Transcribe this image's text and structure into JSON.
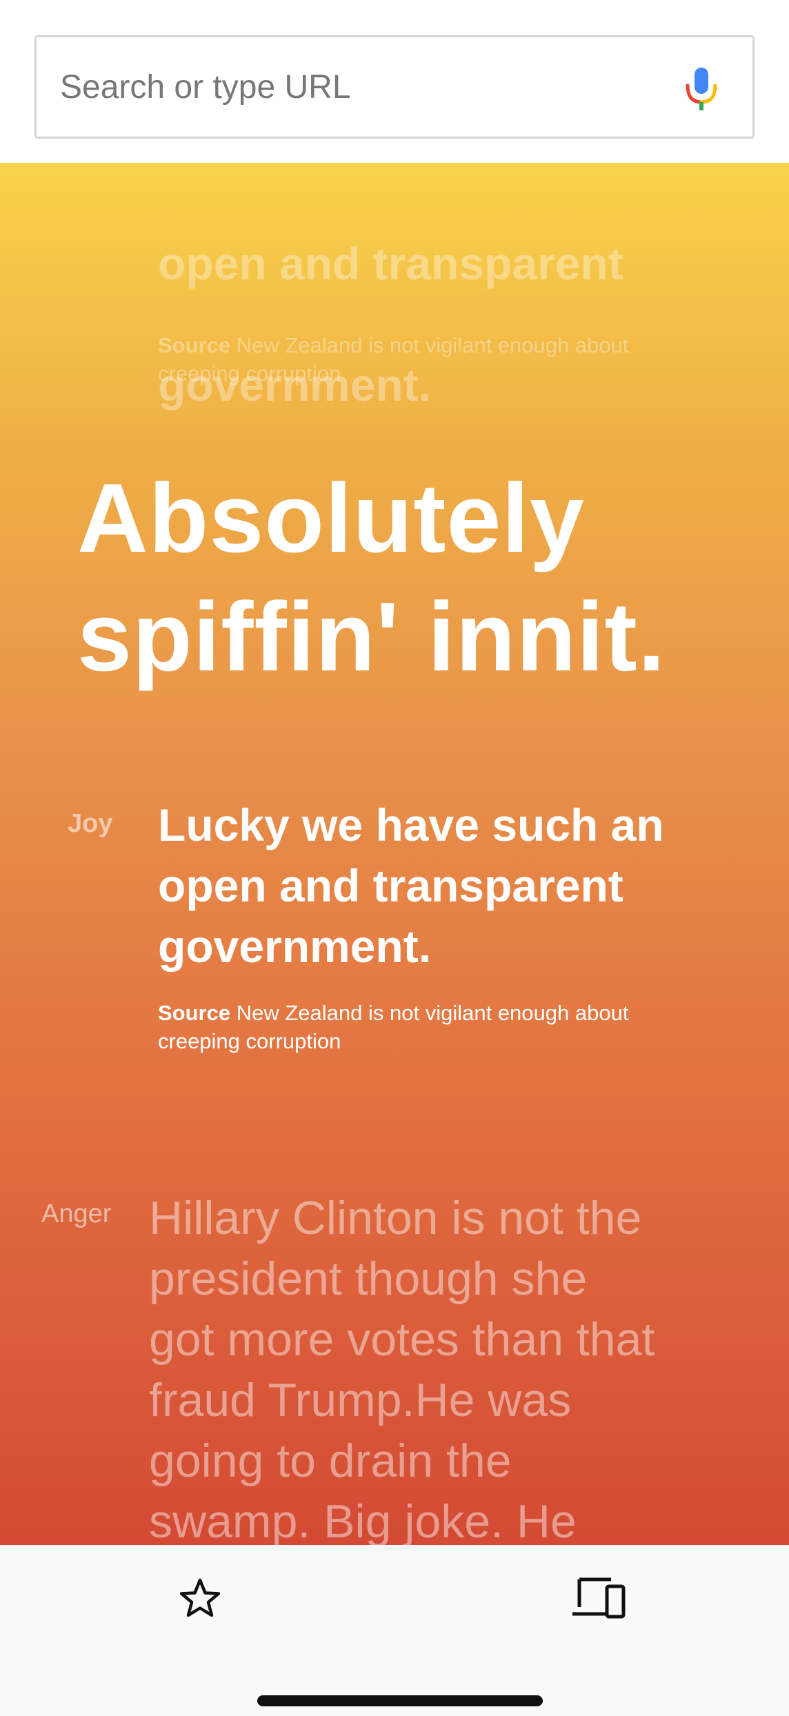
{
  "search": {
    "placeholder": "Search or type URL"
  },
  "icons": {
    "mic": "mic-icon",
    "bookmark": "star-icon",
    "devices": "devices-icon"
  },
  "colors": {
    "gradient_top": "#f8d34b",
    "gradient_bottom": "#d44a34"
  },
  "previous_card": {
    "quote_lines": [
      "open and transparent",
      "government."
    ],
    "source_label": "Source",
    "source_text": "New Zealand is not vigilant enough about creeping corruption"
  },
  "headline": {
    "line1": "Absolutely",
    "line2": "spiffin' innit."
  },
  "joy_card": {
    "emotion": "Joy",
    "quote_lines": [
      "Lucky we have such an",
      "open and transparent",
      "government."
    ],
    "source_label": "Source",
    "source_text": "New Zealand is not vigilant enough about creeping corruption"
  },
  "anger_card": {
    "emotion": "Anger",
    "quote_lines": [
      "Hillary Clinton is not the",
      "president though she",
      "got more votes than that",
      "fraud Trump.He was",
      "going to drain the",
      "swamp. Big joke. He"
    ]
  }
}
